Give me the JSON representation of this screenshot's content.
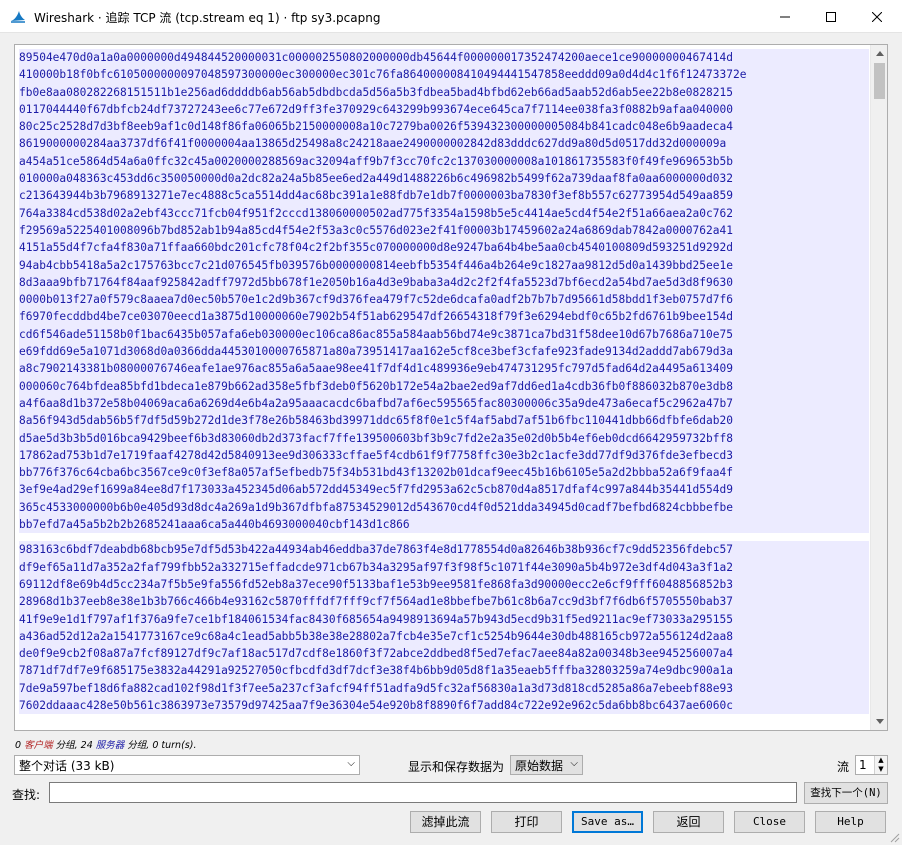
{
  "window": {
    "title": "Wireshark · 追踪 TCP 流 (tcp.stream eq 1) · ftp sy3.pcapng",
    "app_icon": "wireshark-fin-icon",
    "minimize_icon": "minimize-icon",
    "maximize_icon": "maximize-icon",
    "close_icon": "close-icon"
  },
  "stream": {
    "colors": {
      "text": "#1a1aa6",
      "highlight": "#ecebff"
    },
    "block1": [
      "89504e470d0a1a0a0000000d494844520000031c000002550802000000db45644f000000017352474200aece1ce90000000467414d",
      "410000b18f0bfc6105000000097048597300000ec300000ec301c76fa864000008410494441547858eeddd09a0d4d4c1f6f12473372e",
      "fb0e8aa080282268151511b1e256ad6ddddb6ab56ab5dbdbcda5d56a5b3fdbea5bad4bfbd62eb66ad5aab52d6ab5ee22b8e0828215",
      "0117044440f67dbfcb24df73727243ee6c77e672d9ff3fe370929c643299b993674ece645ca7f7114ee038fa3f0882b9afaa040000",
      "80c25c2528d7d3bf8eeb9af1c0d148f86fa06065b2150000008a10c7279ba0026f539432300000005084b841cadc048e6b9aadeca4",
      "8619000000284aa3737df6f41f0000004aa13865d25498a8c24218aae2490000002842d83dddc627dd9a80d5d0517dd32d000009a",
      "a454a51ce5864d54a6a0ffc32c45a0020000288569ac32094aff9b7f3cc70fc2c137030000008a101861735583f0f49fe969653b5b",
      "010000a048363c453dd6c350050000d0a2dc82a24a5b85ee6ed2a449d1488226b6c496982b5499f62a739daaf8fa0aa6000000d032",
      "c213643944b3b7968913271e7ec4888c5ca5514dd4ac68bc391a1e88fdb7e1db7f0000003ba7830f3ef8b557c62773954d549aa859",
      "764a3384cd538d02a2ebf43ccc71fcb04f951f2cccd138060000502ad775f3354a1598b5e5c4414ae5cd4f54e2f51a66aea2a0c762",
      "f29569a5225401008096b7bd852ab1b94a85cd4f54e2f53a3c0c5576d023e2f41f00003b17459602a24a6869dab7842a0000762a41",
      "4151a55d4f7cfa4f830a71ffaa660bdc201cfc78f04c2f2bf355c070000000d8e9247ba64b4be5aa0cb4540100809d593251d9292d",
      "94ab4cbb5418a5a2c175763bcc7c21d076545fb039576b0000000814eebfb5354f446a4b264e9c1827aa9812d5d0a1439bbd25ee1e",
      "8d3aaa9bfb71764f84aaf925842adff7972d5bb678f1e2050b16a4d3e9baba3a4d2c2f2f4fa5523d7bf6ecd2a54bd7ae5d3d8f9630",
      "0000b013f27a0f579c8aaea7d0ec50b570e1c2d9b367cf9d376fea479f7c52de6dcafa0adf2b7b7b7d95661d58bdd1f3eb0757d7f6",
      "f6970fecddbd4be7ce03070eecd1a3875d10000060e7902b54f51ab629547df26654318f79f3e6294ebdf0c65b2fd6761b9bee154d",
      "cd6f546ade51158b0f1bac6435b057afa6eb030000ec106ca86ac855a584aab56bd74e9c3871ca7bd31f58dee10d67b7686a710e75",
      "e69fdd69e5a1071d3068d0a0366dda4453010000765871a80a73951417aa162e5cf8ce3bef3cfafe923fade9134d2addd7ab679d3a",
      "a8c7902143381b08000076746eafe1ae976ac855a6a5aae98ee41f7df4d1c489936e9eb474731295fc797d5fad64d2a4495a613409",
      "000060c764bfdea85bfd1bdeca1e879b662ad358e5fbf3deb0f5620b172e54a2bae2ed9af7dd6ed1a4cdb36fb0f886032b870e3db8",
      "a4f6aa8d1b372e58b04069aca6a6269d4e6b4a2a95aaacacdc6bafbd7af6ec595565fac80300006c35a9de473a6ecaf5c2962a47b7",
      "8a56f943d5dab56b5f7df5d59b272d1de3f78e26b58463bd39971ddc65f8f0e1c5f4af5abd7af51b6fbc110441dbb66dfbfe6dab20",
      "d5ae5d3b3b5d016bca9429beef6b3d83060db2d373facf7ffe139500603bf3b9c7fd2e2a35e02d0b5b4ef6eb0dcd6642959732bff8",
      "17862ad753b1d7e1719faaf4278d42d5840913ee9d306333cffae5f4cdb61f9f7758ffc30e3b2c1acfe3dd77df9d376fde3efbecd3",
      "bb776f376c64cba6bc3567ce9c0f3ef8a057af5efbedb75f34b531bd43f13202b01dcaf9eec45b16b6105e5a2d2bbba52a6f9faa4f",
      "3ef9e4ad29ef1699a84ee8d7f173033a452345d06ab572dd45349ec5f7fd2953a62c5cb870d4a8517dfaf4c997a844b35441d554d9",
      "365c4533000000b6b0e405d93d8dc4a269a1d9b367dfbfa87534529012d543670cd4f0d521dda34945d0cadf7befbd6824cbbbefbe",
      "bb7efd7a45a5b2b2b2685241aaa6ca5a440b4693000040cbf143d1c866"
    ],
    "block2": [
      "983163c6bdf7deabdb68bcb95e7df5d53b422a44934ab46eddba37de7863f4e8d1778554d0a82646b38b936cf7c9dd52356fdebc57",
      "df9ef65a11d7a352a2faf799fbb52a332715effadcde971cb67b34a3295af97f3f98f5c1071f44e3090a5b4b972e3df4d043a3f1a2",
      "69112df8e69b4d5cc234a7f5b5e9fa556fd52eb8a37ece90f5133baf1e53b9ee9581fe868fa3d90000ecc2e6cf9fff6048856852b3",
      "28968d1b37eeb8e38e1b3b766c466b4e93162c5870fffdf7fff9cf7f564ad1e8bbefbe7b61c8b6a7cc9d3bf7f6db6f5705550bab37",
      "41f9e9e1d1f797af1f376a9fe7ce1bf184061534fac8430f685654a9498913694a57b943d5ecd9b31f5ed9211ac9ef73033a295155",
      "a436ad52d12a2a1541773167ce9c68a4c1ead5abb5b38e38e28802a7fcb4e35e7cf1c5254b9644e30db488165cb972a556124d2aa8",
      "de0f9e9cb2f08a87a7fcf89127df9c7af18ac517d7cdf8e1860f3f72abce2ddbed8f5ed7efac7aee84a82a00348b3ee945256007a4",
      "7871df7df7e9f685175e3832a44291a92527050cfbcdfd3df7dcf3e38f4b6bb9d05d8f1a35eaeb5fffba32803259a74e9dbc900a1a",
      "7de9a597bef18d6fa882cad102f98d1f3f7ee5a237cf3afcf94ff51adfa9d5fc32af56830a1a3d73d818cd5285a86a7ebeebf88e93",
      "7602ddaaac428e50b561c3863973e73579d97425aa7f9e36304e54e920b8f8890f6f7add84c722e92e962c5da6bb8bc6437ae6060c"
    ]
  },
  "stats": {
    "p1": "0 ",
    "client": "客户端",
    "p2": " 分组, 24 ",
    "server": "服务器",
    "p3": " 分组, 0 turn(s)."
  },
  "controls": {
    "conversation": "整个对话 (33 kB)",
    "format_label": "显示和保存数据为",
    "format_value": "原始数据",
    "stream_label": "流",
    "stream_value": "1",
    "find_label": "查找:",
    "find_value": "",
    "find_next": "查找下一个(N)"
  },
  "buttons": {
    "filter_out": "滤掉此流",
    "print": "打印",
    "save_as": "Save as…",
    "back": "返回",
    "close": "Close",
    "help": "Help"
  }
}
